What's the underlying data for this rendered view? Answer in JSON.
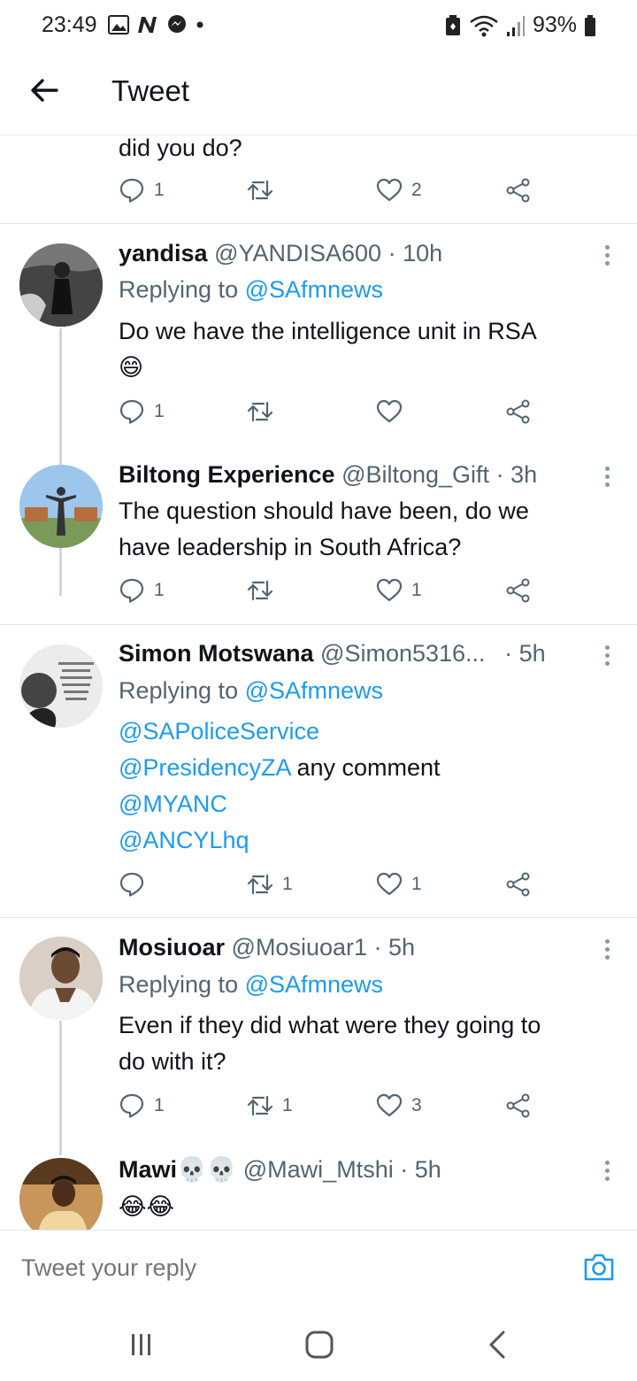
{
  "status": {
    "time": "23:49",
    "battery": "93%"
  },
  "header": {
    "title": "Tweet"
  },
  "prev_tweet": {
    "text_tail": "did you do?",
    "reply_count": "1",
    "retweet_count": "",
    "like_count": "2"
  },
  "tweets": [
    {
      "name": "yandisa",
      "handle": "@YANDISA600",
      "time": "· 10h",
      "replying_prefix": "Replying to ",
      "replying_to": "@SAfmnews",
      "text": "Do we have the intelligence unit in RSA",
      "emoji": "😄",
      "reply_count": "1",
      "retweet_count": "",
      "like_count": ""
    },
    {
      "name": "Biltong Experience",
      "handle": "@Biltong_Gift",
      "time": "· 3h",
      "text_line1": "The question should have been, do we",
      "text_line2": "have leadership in South Africa?",
      "reply_count": "1",
      "retweet_count": "",
      "like_count": "1"
    },
    {
      "name": "Simon Motswana",
      "handle": "@Simon5316...",
      "time": "· 5h",
      "replying_prefix": "Replying to ",
      "replying_to": "@SAfmnews",
      "mention1": "@SAPoliceService",
      "mention2": "@PresidencyZA",
      "text_after_mention2": " any comment",
      "mention3": "@MYANC",
      "mention4": "@ANCYLhq",
      "reply_count": "",
      "retweet_count": "1",
      "like_count": "1"
    },
    {
      "name": "Mosiuoar",
      "handle": "@Mosiuoar1",
      "time": "· 5h",
      "replying_prefix": "Replying to ",
      "replying_to": "@SAfmnews",
      "text_line1": "Even if they did what were they going to",
      "text_line2": "do with it?",
      "reply_count": "1",
      "retweet_count": "1",
      "like_count": "3"
    },
    {
      "name": "Mawi💀💀",
      "handle": "@Mawi_Mtshi",
      "time": "· 5h",
      "text": "😂😂"
    }
  ],
  "reply_bar": {
    "placeholder": "Tweet your reply"
  },
  "colors": {
    "link": "#1d9bf0",
    "muted": "#536471",
    "text": "#0f1419"
  }
}
